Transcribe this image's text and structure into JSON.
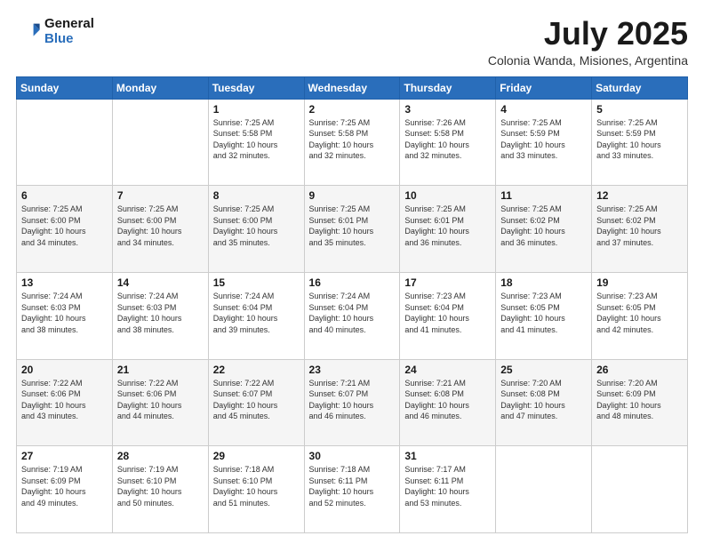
{
  "logo": {
    "line1": "General",
    "line2": "Blue"
  },
  "title": "July 2025",
  "subtitle": "Colonia Wanda, Misiones, Argentina",
  "days_header": [
    "Sunday",
    "Monday",
    "Tuesday",
    "Wednesday",
    "Thursday",
    "Friday",
    "Saturday"
  ],
  "weeks": [
    [
      {
        "day": "",
        "info": ""
      },
      {
        "day": "",
        "info": ""
      },
      {
        "day": "1",
        "info": "Sunrise: 7:25 AM\nSunset: 5:58 PM\nDaylight: 10 hours\nand 32 minutes."
      },
      {
        "day": "2",
        "info": "Sunrise: 7:25 AM\nSunset: 5:58 PM\nDaylight: 10 hours\nand 32 minutes."
      },
      {
        "day": "3",
        "info": "Sunrise: 7:26 AM\nSunset: 5:58 PM\nDaylight: 10 hours\nand 32 minutes."
      },
      {
        "day": "4",
        "info": "Sunrise: 7:25 AM\nSunset: 5:59 PM\nDaylight: 10 hours\nand 33 minutes."
      },
      {
        "day": "5",
        "info": "Sunrise: 7:25 AM\nSunset: 5:59 PM\nDaylight: 10 hours\nand 33 minutes."
      }
    ],
    [
      {
        "day": "6",
        "info": "Sunrise: 7:25 AM\nSunset: 6:00 PM\nDaylight: 10 hours\nand 34 minutes."
      },
      {
        "day": "7",
        "info": "Sunrise: 7:25 AM\nSunset: 6:00 PM\nDaylight: 10 hours\nand 34 minutes."
      },
      {
        "day": "8",
        "info": "Sunrise: 7:25 AM\nSunset: 6:00 PM\nDaylight: 10 hours\nand 35 minutes."
      },
      {
        "day": "9",
        "info": "Sunrise: 7:25 AM\nSunset: 6:01 PM\nDaylight: 10 hours\nand 35 minutes."
      },
      {
        "day": "10",
        "info": "Sunrise: 7:25 AM\nSunset: 6:01 PM\nDaylight: 10 hours\nand 36 minutes."
      },
      {
        "day": "11",
        "info": "Sunrise: 7:25 AM\nSunset: 6:02 PM\nDaylight: 10 hours\nand 36 minutes."
      },
      {
        "day": "12",
        "info": "Sunrise: 7:25 AM\nSunset: 6:02 PM\nDaylight: 10 hours\nand 37 minutes."
      }
    ],
    [
      {
        "day": "13",
        "info": "Sunrise: 7:24 AM\nSunset: 6:03 PM\nDaylight: 10 hours\nand 38 minutes."
      },
      {
        "day": "14",
        "info": "Sunrise: 7:24 AM\nSunset: 6:03 PM\nDaylight: 10 hours\nand 38 minutes."
      },
      {
        "day": "15",
        "info": "Sunrise: 7:24 AM\nSunset: 6:04 PM\nDaylight: 10 hours\nand 39 minutes."
      },
      {
        "day": "16",
        "info": "Sunrise: 7:24 AM\nSunset: 6:04 PM\nDaylight: 10 hours\nand 40 minutes."
      },
      {
        "day": "17",
        "info": "Sunrise: 7:23 AM\nSunset: 6:04 PM\nDaylight: 10 hours\nand 41 minutes."
      },
      {
        "day": "18",
        "info": "Sunrise: 7:23 AM\nSunset: 6:05 PM\nDaylight: 10 hours\nand 41 minutes."
      },
      {
        "day": "19",
        "info": "Sunrise: 7:23 AM\nSunset: 6:05 PM\nDaylight: 10 hours\nand 42 minutes."
      }
    ],
    [
      {
        "day": "20",
        "info": "Sunrise: 7:22 AM\nSunset: 6:06 PM\nDaylight: 10 hours\nand 43 minutes."
      },
      {
        "day": "21",
        "info": "Sunrise: 7:22 AM\nSunset: 6:06 PM\nDaylight: 10 hours\nand 44 minutes."
      },
      {
        "day": "22",
        "info": "Sunrise: 7:22 AM\nSunset: 6:07 PM\nDaylight: 10 hours\nand 45 minutes."
      },
      {
        "day": "23",
        "info": "Sunrise: 7:21 AM\nSunset: 6:07 PM\nDaylight: 10 hours\nand 46 minutes."
      },
      {
        "day": "24",
        "info": "Sunrise: 7:21 AM\nSunset: 6:08 PM\nDaylight: 10 hours\nand 46 minutes."
      },
      {
        "day": "25",
        "info": "Sunrise: 7:20 AM\nSunset: 6:08 PM\nDaylight: 10 hours\nand 47 minutes."
      },
      {
        "day": "26",
        "info": "Sunrise: 7:20 AM\nSunset: 6:09 PM\nDaylight: 10 hours\nand 48 minutes."
      }
    ],
    [
      {
        "day": "27",
        "info": "Sunrise: 7:19 AM\nSunset: 6:09 PM\nDaylight: 10 hours\nand 49 minutes."
      },
      {
        "day": "28",
        "info": "Sunrise: 7:19 AM\nSunset: 6:10 PM\nDaylight: 10 hours\nand 50 minutes."
      },
      {
        "day": "29",
        "info": "Sunrise: 7:18 AM\nSunset: 6:10 PM\nDaylight: 10 hours\nand 51 minutes."
      },
      {
        "day": "30",
        "info": "Sunrise: 7:18 AM\nSunset: 6:11 PM\nDaylight: 10 hours\nand 52 minutes."
      },
      {
        "day": "31",
        "info": "Sunrise: 7:17 AM\nSunset: 6:11 PM\nDaylight: 10 hours\nand 53 minutes."
      },
      {
        "day": "",
        "info": ""
      },
      {
        "day": "",
        "info": ""
      }
    ]
  ]
}
